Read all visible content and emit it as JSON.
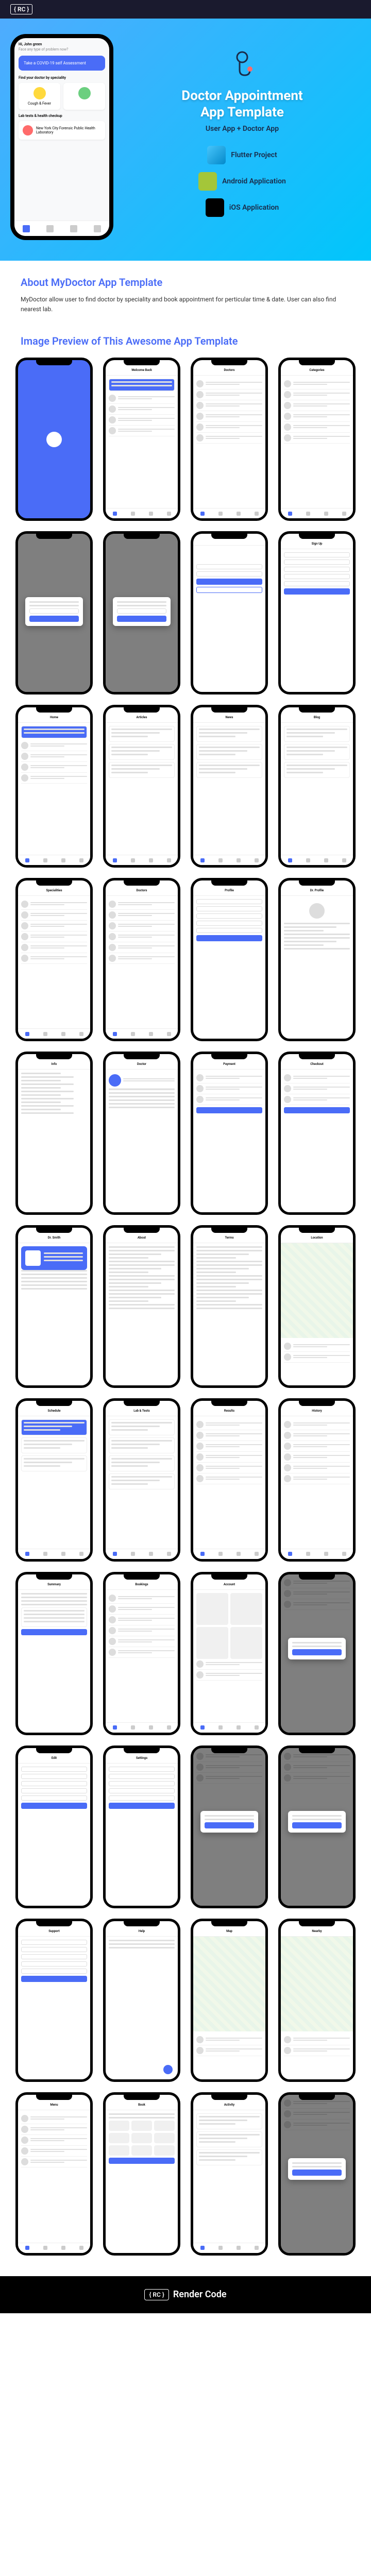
{
  "header": {
    "logo": "{ RC }"
  },
  "hero": {
    "title": "Doctor Appointment\nApp Template",
    "subtitle": "User App + Doctor App",
    "phone": {
      "greeting": "Hi, John green",
      "question": "Face any type of problem now?",
      "covid_title": "Take a COVID-19 self Assessment",
      "find_doctor": "Find your doctor by speciality",
      "specialty1": "Cough & Fever",
      "specialty2": "",
      "lab_title": "Lab tests & health checkup",
      "lab_name": "New York City Forensic Public Health Laboratory"
    },
    "tech": {
      "flutter": "Flutter Project",
      "android": "Android Application",
      "ios": "iOS Application"
    }
  },
  "about": {
    "title": "About MyDoctor App Template",
    "text": "MyDoctor allow user to find doctor by speciality and book appointment for perticular time & date. User can also find nearest lab."
  },
  "preview": {
    "title": "Image Preview of This Awesome App Template"
  },
  "phones": [
    {
      "type": "splash",
      "variant": "blue"
    },
    {
      "type": "home",
      "title": "Welcome Back"
    },
    {
      "type": "list",
      "title": "Doctors"
    },
    {
      "type": "list",
      "title": "Categories"
    },
    {
      "type": "modal",
      "title": ""
    },
    {
      "type": "modal",
      "title": ""
    },
    {
      "type": "login",
      "title": ""
    },
    {
      "type": "form",
      "title": "Sign Up"
    },
    {
      "type": "home",
      "title": "Home"
    },
    {
      "type": "feed",
      "title": "Articles"
    },
    {
      "type": "feed",
      "title": "News"
    },
    {
      "type": "feed",
      "title": "Blog"
    },
    {
      "type": "list",
      "title": "Specialities"
    },
    {
      "type": "list",
      "title": "Doctors"
    },
    {
      "type": "form",
      "title": "Profile"
    },
    {
      "type": "detail",
      "title": "Dr. Profile"
    },
    {
      "type": "thin",
      "title": "Info"
    },
    {
      "type": "profile",
      "title": "Doctor"
    },
    {
      "type": "payment",
      "title": "Payment"
    },
    {
      "type": "payment",
      "title": "Checkout"
    },
    {
      "type": "doctor",
      "title": "Dr. Smith"
    },
    {
      "type": "text",
      "title": "About"
    },
    {
      "type": "text",
      "title": "Terms"
    },
    {
      "type": "map",
      "title": "Location"
    },
    {
      "type": "appointments",
      "title": "Schedule"
    },
    {
      "type": "labs",
      "title": "Lab & Tests"
    },
    {
      "type": "list",
      "title": "Results"
    },
    {
      "type": "list",
      "title": "History"
    },
    {
      "type": "summary",
      "title": "Summary"
    },
    {
      "type": "list",
      "title": "Bookings"
    },
    {
      "type": "grid",
      "title": "Account"
    },
    {
      "type": "alert",
      "title": ""
    },
    {
      "type": "form",
      "title": "Edit"
    },
    {
      "type": "form",
      "title": "Settings"
    },
    {
      "type": "alert",
      "title": ""
    },
    {
      "type": "alert",
      "title": ""
    },
    {
      "type": "form",
      "title": "Support"
    },
    {
      "type": "simple",
      "title": "Help"
    },
    {
      "type": "map",
      "title": "Map"
    },
    {
      "type": "map",
      "title": "Nearby"
    },
    {
      "type": "menu",
      "title": "Menu"
    },
    {
      "type": "slot",
      "title": "Book"
    },
    {
      "type": "feed",
      "title": "Activity"
    },
    {
      "type": "alert",
      "title": ""
    }
  ],
  "footer": {
    "badge": "{ RC }",
    "name": "Render Code"
  }
}
